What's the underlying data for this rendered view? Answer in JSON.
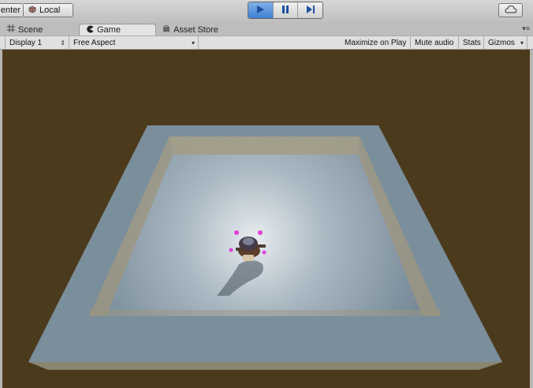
{
  "toolbar": {
    "pivot_label": "enter",
    "space_label": "Local"
  },
  "tabs": {
    "scene": "Scene",
    "game": "Game",
    "asset_store": "Asset Store"
  },
  "game_view": {
    "display": "Display 1",
    "aspect": "Free Aspect",
    "maximize": "Maximize on Play",
    "mute": "Mute audio",
    "stats": "Stats",
    "gizmos": "Gizmos"
  },
  "colors": {
    "background": "#4c3a1d",
    "floor": "#7f93a1",
    "play_accent": "#3f7fd0"
  },
  "icons": [
    "cube-icon",
    "play-icon",
    "pause-icon",
    "step-icon",
    "cloud-icon",
    "grid-icon",
    "pacman-icon",
    "bag-icon",
    "tab-menu-icon"
  ]
}
